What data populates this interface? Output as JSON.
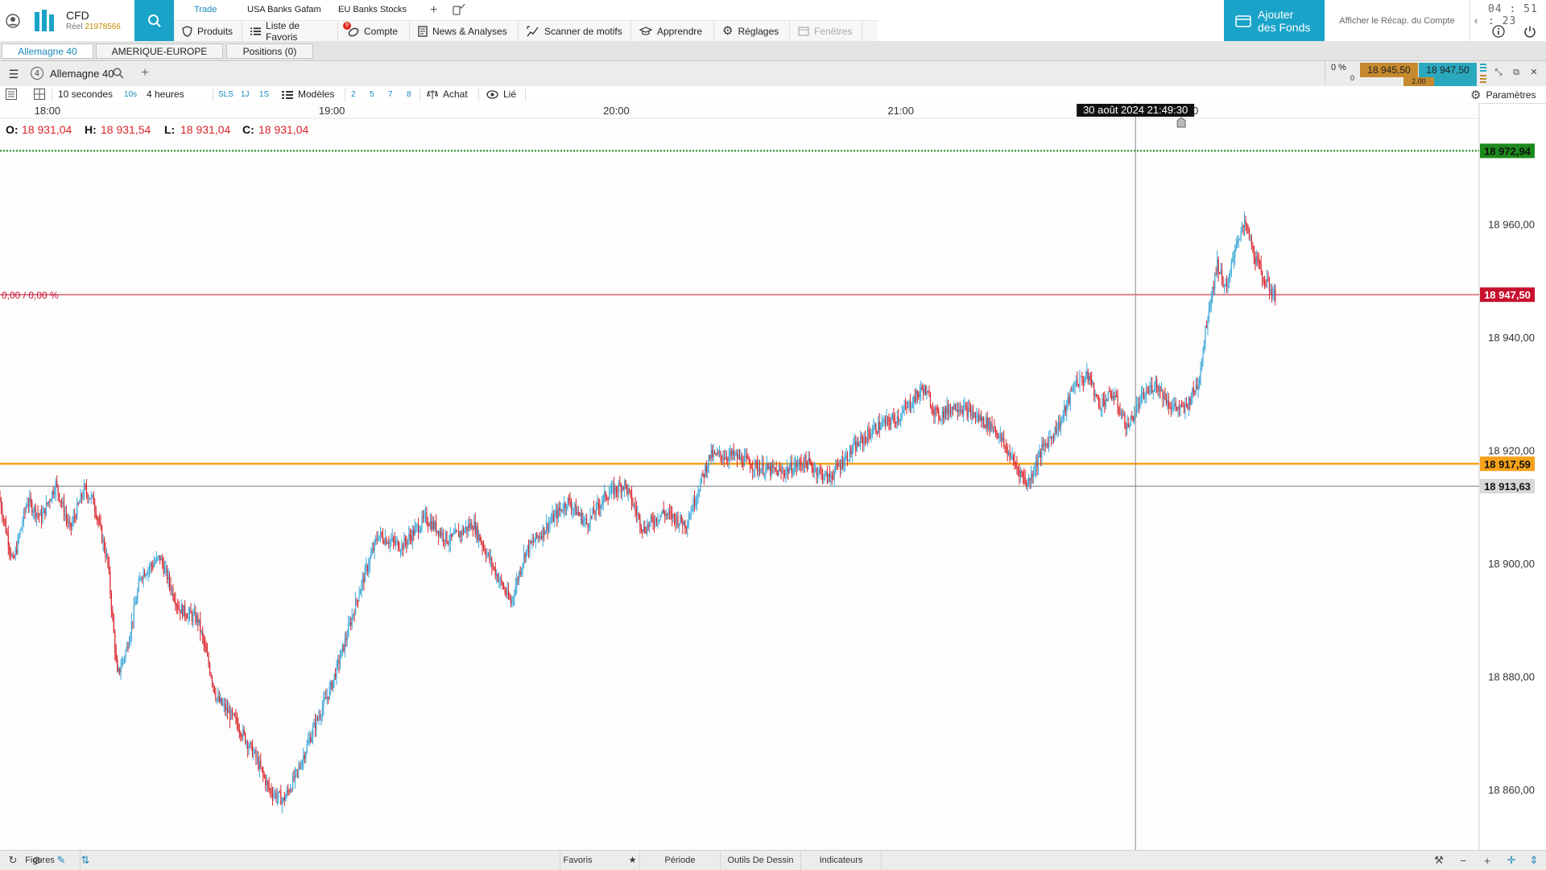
{
  "app": {
    "brand_title": "CFD",
    "brand_sub_label": "Réel",
    "brand_account": "21978566",
    "clock": "04 : 51 : 23",
    "add_funds_line1": "Ajouter",
    "add_funds_line2": "des Fonds",
    "recap_label": "Afficher le Récap. du Compte"
  },
  "quick_tabs": [
    {
      "label": "Trade",
      "active": true
    },
    {
      "label": "USA Banks Gafam",
      "active": false
    },
    {
      "label": "EU Banks Stocks",
      "active": false
    }
  ],
  "quick_add": "+",
  "menu": [
    {
      "label": "Produits",
      "icon": "shield-icon"
    },
    {
      "label": "Liste de Favoris",
      "icon": "list-icon"
    },
    {
      "label": "Compte",
      "icon": "account-icon",
      "badge": "9"
    },
    {
      "label": "News & Analyses",
      "icon": "news-icon"
    },
    {
      "label": "Scanner de motifs",
      "icon": "scanner-icon"
    },
    {
      "label": "Apprendre",
      "icon": "graduation-cap-icon"
    },
    {
      "label": "Réglages",
      "icon": "gear-icon"
    },
    {
      "label": "Fenêtres",
      "icon": "window-icon",
      "disabled": true
    }
  ],
  "workspace_tabs": [
    {
      "label": "Allemagne 40",
      "active": true
    },
    {
      "label": "AMERIQUE-EUROPE",
      "active": false
    },
    {
      "label": "Positions (0)",
      "active": false
    }
  ],
  "chart_header": {
    "badge": "4",
    "instrument": "Allemagne 40",
    "add": "+",
    "pct_change": "0 %",
    "pct_count": "0",
    "bid": "18 945,50",
    "ask": "18 947,50",
    "spread": "2.00"
  },
  "toolbar": {
    "interval": "10 secondes",
    "interval_short": "10s",
    "span": "4 heures",
    "quick_spans": [
      "SLS",
      "1J",
      "1S"
    ],
    "templates": "Modèles",
    "presets": [
      "2",
      "5",
      "7",
      "8"
    ],
    "buy": "Achat",
    "linked": "Lié",
    "settings": "Paramètres"
  },
  "chart_data": {
    "type": "candlestick",
    "instrument": "Allemagne 40",
    "ohlc_labels": {
      "o": "O:",
      "h": "H:",
      "l": "L:",
      "c": "C:"
    },
    "ohlc_values": {
      "o": "18 931,04",
      "h": "18 931,54",
      "l": "18 931,04",
      "c": "18 931,04"
    },
    "change_label": "0,00 / 0,00 %",
    "x_ticks": [
      "18:00",
      "19:00",
      "20:00",
      "21:00",
      "22:00"
    ],
    "crosshair_time": "30 août 2024 21:49:30",
    "y_ticks": [
      "18 960,00",
      "18 940,00",
      "18 920,00",
      "18 900,00",
      "18 880,00",
      "18 860,00"
    ],
    "y_tick_values": [
      18960,
      18940,
      18920,
      18900,
      18880,
      18860
    ],
    "ylim": [
      18849.3,
      18981.4
    ],
    "xlim_minutes": [
      1070,
      1382
    ],
    "x_tick_minutes": [
      1080,
      1140,
      1200,
      1260,
      1320
    ],
    "crosshair_minute": 1309.5,
    "levels": [
      {
        "name": "high-level",
        "value": 18972.94,
        "label": "18 972,94",
        "color": "#1c8a1c",
        "style": "dotted"
      },
      {
        "name": "current-price",
        "value": 18947.5,
        "label": "18 947,50",
        "color": "#c8102e",
        "style": "solid"
      },
      {
        "name": "support-level",
        "value": 18917.59,
        "label": "18 917,59",
        "color": "#f7a21b",
        "style": "thick"
      },
      {
        "name": "open-price",
        "value": 18913.63,
        "label": "18 913,63",
        "color": "#777777",
        "style": "solid"
      }
    ],
    "series": {
      "start_minute": 1070,
      "end_minute": 1310,
      "path": [
        [
          1070,
          18912
        ],
        [
          1073,
          18900
        ],
        [
          1076,
          18911
        ],
        [
          1079,
          18908
        ],
        [
          1082,
          18914
        ],
        [
          1085,
          18906
        ],
        [
          1088,
          18913
        ],
        [
          1090,
          18911
        ],
        [
          1093,
          18900
        ],
        [
          1095,
          18880
        ],
        [
          1097,
          18885
        ],
        [
          1100,
          18898
        ],
        [
          1104,
          18901
        ],
        [
          1108,
          18892
        ],
        [
          1112,
          18890
        ],
        [
          1116,
          18876
        ],
        [
          1120,
          18872
        ],
        [
          1124,
          18866
        ],
        [
          1127,
          18860
        ],
        [
          1130,
          18858
        ],
        [
          1133,
          18863
        ],
        [
          1136,
          18870
        ],
        [
          1140,
          18878
        ],
        [
          1143,
          18886
        ],
        [
          1146,
          18895
        ],
        [
          1150,
          18905
        ],
        [
          1155,
          18903
        ],
        [
          1160,
          18908
        ],
        [
          1165,
          18904
        ],
        [
          1170,
          18907
        ],
        [
          1175,
          18898
        ],
        [
          1178,
          18893
        ],
        [
          1181,
          18902
        ],
        [
          1185,
          18906
        ],
        [
          1190,
          18911
        ],
        [
          1194,
          18907
        ],
        [
          1198,
          18912
        ],
        [
          1202,
          18914
        ],
        [
          1206,
          18906
        ],
        [
          1210,
          18909
        ],
        [
          1215,
          18907
        ],
        [
          1220,
          18919
        ],
        [
          1225,
          18919
        ],
        [
          1230,
          18917
        ],
        [
          1235,
          18916
        ],
        [
          1240,
          18918
        ],
        [
          1245,
          18915
        ],
        [
          1250,
          18920
        ],
        [
          1255,
          18924
        ],
        [
          1260,
          18926
        ],
        [
          1265,
          18931
        ],
        [
          1268,
          18926
        ],
        [
          1272,
          18928
        ],
        [
          1276,
          18926
        ],
        [
          1280,
          18924
        ],
        [
          1284,
          18918
        ],
        [
          1287,
          18914
        ],
        [
          1290,
          18920
        ],
        [
          1294,
          18925
        ],
        [
          1297,
          18932
        ],
        [
          1300,
          18933
        ],
        [
          1302,
          18928
        ],
        [
          1305,
          18930
        ],
        [
          1308,
          18924
        ],
        [
          1311,
          18929
        ],
        [
          1314,
          18932
        ],
        [
          1317,
          18928
        ],
        [
          1320,
          18927
        ],
        [
          1323,
          18932
        ],
        [
          1325,
          18944
        ],
        [
          1327,
          18953
        ],
        [
          1329,
          18948
        ],
        [
          1331,
          18957
        ],
        [
          1333,
          18960
        ],
        [
          1335,
          18954
        ],
        [
          1337,
          18950
        ],
        [
          1339,
          18947.5
        ]
      ]
    }
  },
  "bottom": {
    "favorites": "Favoris",
    "period": "Période",
    "drawing_tools": "Outils De Dessin",
    "indicators": "Indicateurs",
    "figures": "Figures"
  }
}
